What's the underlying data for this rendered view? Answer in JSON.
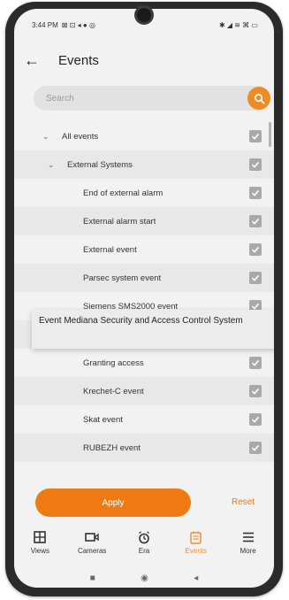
{
  "status_bar": {
    "time_text": "3:44 PM",
    "left_icons": "⊠ ⊡ ◂ ● ◎",
    "right_icons": "✱ ◢ ≋ ⌘ ▭"
  },
  "header": {
    "title": "Events"
  },
  "search": {
    "placeholder": "Search"
  },
  "events": [
    {
      "label": "All events",
      "level": 0,
      "expand": "⌄"
    },
    {
      "label": "External Systems",
      "level": 1,
      "expand": "⌄"
    },
    {
      "label": "End of external alarm",
      "level": 2
    },
    {
      "label": "External alarm start",
      "level": 2
    },
    {
      "label": "External event",
      "level": 2
    },
    {
      "label": "Parsec system event",
      "level": 2
    },
    {
      "label": "Siemens SMS2000 event",
      "level": 2
    },
    {
      "label": "Event Mediana Security and Access Cont...",
      "level": 2
    },
    {
      "label": "Granting access",
      "level": 2
    },
    {
      "label": "Krechet-C event",
      "level": 2
    },
    {
      "label": "Skat event",
      "level": 2
    },
    {
      "label": "RUBEZH event",
      "level": 2
    }
  ],
  "tooltip": {
    "text": "Event Mediana Security and Access Control System"
  },
  "actions": {
    "apply_label": "Apply",
    "reset_label": "Reset"
  },
  "nav": [
    {
      "label": "Views",
      "icon": "grid-icon"
    },
    {
      "label": "Cameras",
      "icon": "camera-icon"
    },
    {
      "label": "Era",
      "icon": "alarm-clock-icon"
    },
    {
      "label": "Events",
      "icon": "events-icon",
      "active": true
    },
    {
      "label": "More",
      "icon": "menu-icon"
    }
  ],
  "colors": {
    "accent": "#f07a12",
    "checkbox": "#a9a9a9",
    "alt_row": "#e8e8e8"
  }
}
